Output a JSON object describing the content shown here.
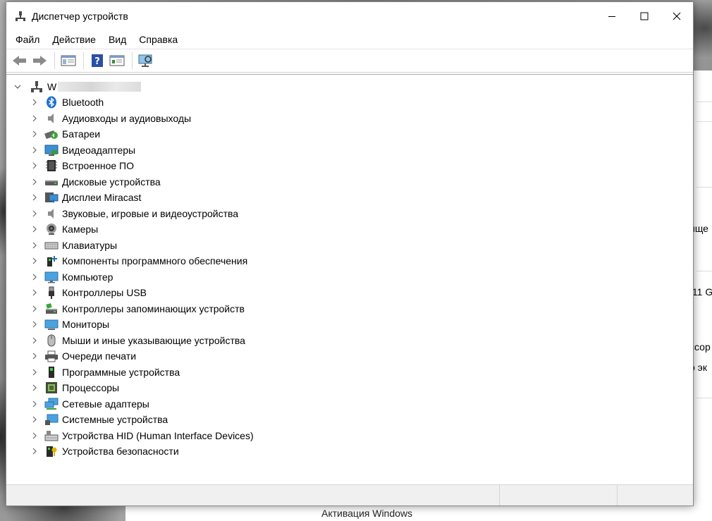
{
  "window": {
    "title": "Диспетчер устройств"
  },
  "menu": [
    "Файл",
    "Действие",
    "Вид",
    "Справка"
  ],
  "tree": {
    "root_name": "W",
    "categories": [
      {
        "label": "Bluetooth",
        "icon": "bluetooth-icon"
      },
      {
        "label": "Аудиовходы и аудиовыходы",
        "icon": "speaker-icon"
      },
      {
        "label": "Батареи",
        "icon": "battery-icon"
      },
      {
        "label": "Видеоадаптеры",
        "icon": "display-adapter-icon"
      },
      {
        "label": "Встроенное ПО",
        "icon": "firmware-chip-icon"
      },
      {
        "label": "Дисковые устройства",
        "icon": "disk-drive-icon"
      },
      {
        "label": "Дисплеи Miracast",
        "icon": "miracast-icon"
      },
      {
        "label": "Звуковые, игровые и видеоустройства",
        "icon": "sound-icon"
      },
      {
        "label": "Камеры",
        "icon": "camera-icon"
      },
      {
        "label": "Клавиатуры",
        "icon": "keyboard-icon"
      },
      {
        "label": "Компоненты программного обеспечения",
        "icon": "software-component-icon"
      },
      {
        "label": "Компьютер",
        "icon": "computer-icon"
      },
      {
        "label": "Контроллеры USB",
        "icon": "usb-icon"
      },
      {
        "label": "Контроллеры запоминающих устройств",
        "icon": "storage-controller-icon"
      },
      {
        "label": "Мониторы",
        "icon": "monitor-icon"
      },
      {
        "label": "Мыши и иные указывающие устройства",
        "icon": "mouse-icon"
      },
      {
        "label": "Очереди печати",
        "icon": "printer-icon"
      },
      {
        "label": "Программные устройства",
        "icon": "software-device-icon"
      },
      {
        "label": "Процессоры",
        "icon": "processor-icon"
      },
      {
        "label": "Сетевые адаптеры",
        "icon": "network-adapter-icon"
      },
      {
        "label": "Системные устройства",
        "icon": "system-device-icon"
      },
      {
        "label": "Устройства HID (Human Interface Devices)",
        "icon": "hid-icon"
      },
      {
        "label": "Устройства безопасности",
        "icon": "security-device-icon"
      }
    ]
  },
  "background": {
    "fragments": [
      "ище",
      ".11 G",
      "ссор",
      "о эк"
    ],
    "activation_text": "Активация Windows"
  }
}
